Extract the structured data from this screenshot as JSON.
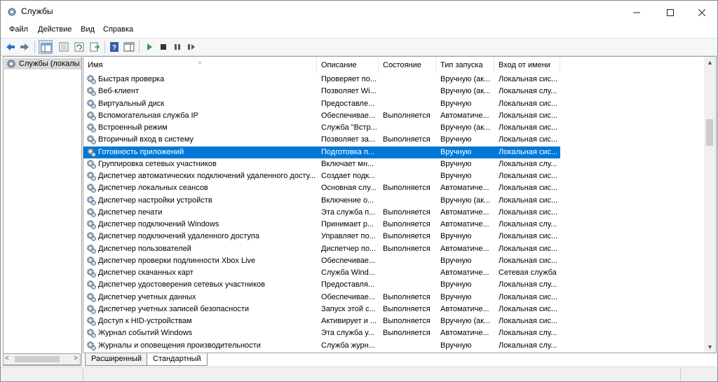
{
  "window": {
    "title": "Службы",
    "icon": "services-gear-icon"
  },
  "menu": [
    "Файл",
    "Действие",
    "Вид",
    "Справка"
  ],
  "tree": {
    "root_label": "Службы (локалы"
  },
  "columns": [
    "Имя",
    "Описание",
    "Состояние",
    "Тип запуска",
    "Вход от имени"
  ],
  "rows": [
    {
      "name": "Быстрая проверка",
      "desc": "Проверяет по...",
      "state": "",
      "start": "Вручную (ак...",
      "logon": "Локальная сис..."
    },
    {
      "name": "Веб-клиент",
      "desc": "Позволяет Wi...",
      "state": "",
      "start": "Вручную (ак...",
      "logon": "Локальная слу..."
    },
    {
      "name": "Виртуальный диск",
      "desc": "Предоставле...",
      "state": "",
      "start": "Вручную",
      "logon": "Локальная сис..."
    },
    {
      "name": "Вспомогательная служба IP",
      "desc": "Обеспечивае...",
      "state": "Выполняется",
      "start": "Автоматиче...",
      "logon": "Локальная сис..."
    },
    {
      "name": "Встроенный режим",
      "desc": "Служба \"Встр...",
      "state": "",
      "start": "Вручную (ак...",
      "logon": "Локальная сис..."
    },
    {
      "name": "Вторичный вход в систему",
      "desc": "Позволяет за...",
      "state": "Выполняется",
      "start": "Вручную",
      "logon": "Локальная сис..."
    },
    {
      "name": "Готовность приложений",
      "desc": "Подготовка п...",
      "state": "",
      "start": "Вручную",
      "logon": "Локальная сис..."
    },
    {
      "name": "Группировка сетевых участников",
      "desc": "Включает мн...",
      "state": "",
      "start": "Вручную",
      "logon": "Локальная слу..."
    },
    {
      "name": "Диспетчер автоматических подключений удаленного досту...",
      "desc": "Создает подк...",
      "state": "",
      "start": "Вручную",
      "logon": "Локальная сис..."
    },
    {
      "name": "Диспетчер локальных сеансов",
      "desc": "Основная слу...",
      "state": "Выполняется",
      "start": "Автоматиче...",
      "logon": "Локальная сис..."
    },
    {
      "name": "Диспетчер настройки устройств",
      "desc": "Включение о...",
      "state": "",
      "start": "Вручную (ак...",
      "logon": "Локальная сис..."
    },
    {
      "name": "Диспетчер печати",
      "desc": "Эта служба п...",
      "state": "Выполняется",
      "start": "Автоматиче...",
      "logon": "Локальная сис..."
    },
    {
      "name": "Диспетчер подключений Windows",
      "desc": "Принимает р...",
      "state": "Выполняется",
      "start": "Автоматиче...",
      "logon": "Локальная слу..."
    },
    {
      "name": "Диспетчер подключений удаленного доступа",
      "desc": "Управляет по...",
      "state": "Выполняется",
      "start": "Вручную",
      "logon": "Локальная сис..."
    },
    {
      "name": "Диспетчер пользователей",
      "desc": "Диспетчер по...",
      "state": "Выполняется",
      "start": "Автоматиче...",
      "logon": "Локальная сис..."
    },
    {
      "name": "Диспетчер проверки подлинности Xbox Live",
      "desc": "Обеспечивае...",
      "state": "",
      "start": "Вручную",
      "logon": "Локальная сис..."
    },
    {
      "name": "Диспетчер скачанных карт",
      "desc": "Служба Wind...",
      "state": "",
      "start": "Автоматиче...",
      "logon": "Сетевая служба"
    },
    {
      "name": "Диспетчер удостоверения сетевых участников",
      "desc": "Предоставля...",
      "state": "",
      "start": "Вручную",
      "logon": "Локальная слу..."
    },
    {
      "name": "Диспетчер учетных данных",
      "desc": "Обеспечивае...",
      "state": "Выполняется",
      "start": "Вручную",
      "logon": "Локальная сис..."
    },
    {
      "name": "Диспетчер учетных записей безопасности",
      "desc": "Запуск этой с...",
      "state": "Выполняется",
      "start": "Автоматиче...",
      "logon": "Локальная сис..."
    },
    {
      "name": "Доступ к HID-устройствам",
      "desc": "Активирует и ...",
      "state": "Выполняется",
      "start": "Вручную (ак...",
      "logon": "Локальная сис..."
    },
    {
      "name": "Журнал событий Windows",
      "desc": "Эта служба у...",
      "state": "Выполняется",
      "start": "Автоматиче...",
      "logon": "Локальная слу..."
    },
    {
      "name": "Журналы и оповещения производительности",
      "desc": "Служба журн...",
      "state": "",
      "start": "Вручную",
      "logon": "Локальная слу..."
    }
  ],
  "selected_row": 6,
  "tabs": [
    "Расширенный",
    "Стандартный"
  ],
  "active_tab": 1,
  "colors": {
    "selection": "#0078d7",
    "accent_green": "#2ea043"
  }
}
